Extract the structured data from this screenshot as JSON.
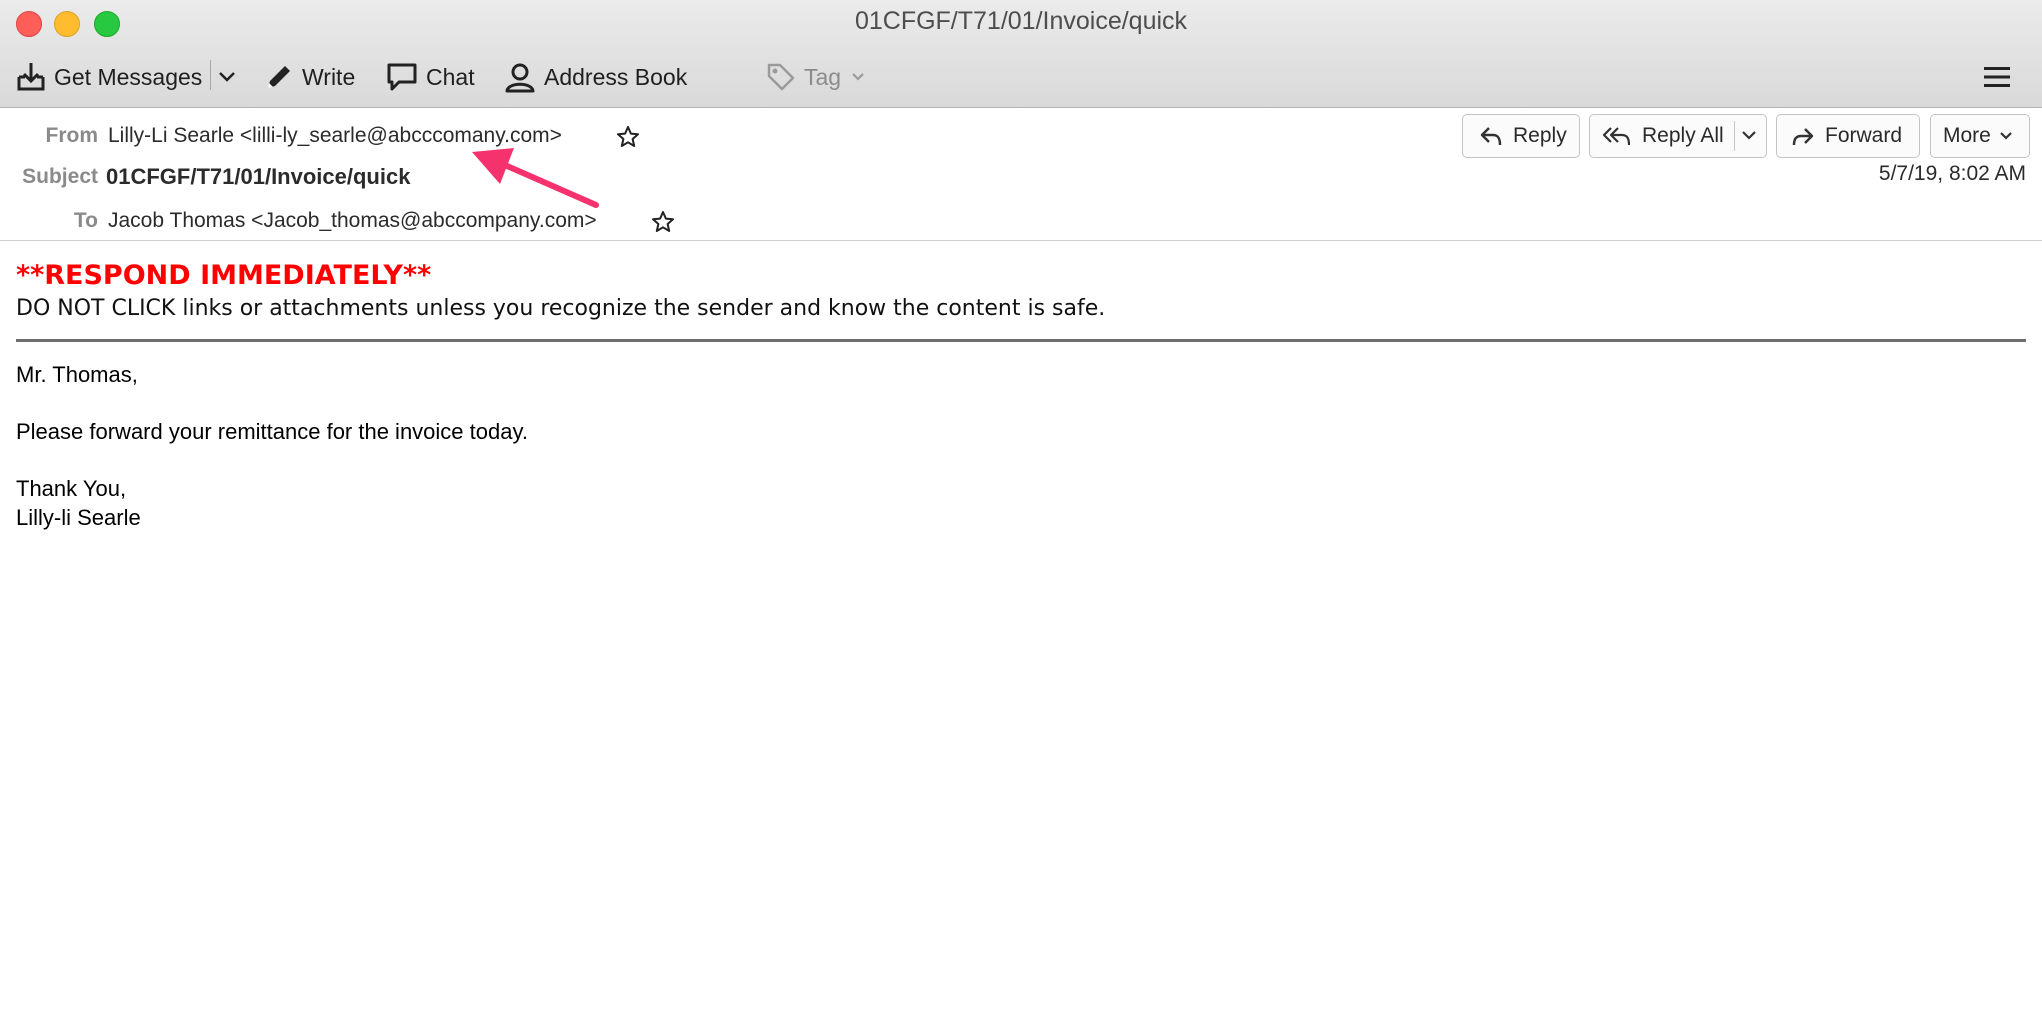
{
  "window": {
    "title": "01CFGF/T71/01/Invoice/quick"
  },
  "toolbar": {
    "get_messages": "Get Messages",
    "write": "Write",
    "chat": "Chat",
    "address_book": "Address Book",
    "tag": "Tag"
  },
  "header": {
    "from_label": "From",
    "from_value": "Lilly-Li Searle <lilli-ly_searle@abcccomany.com>",
    "subject_label": "Subject",
    "subject_value": "01CFGF/T71/01/Invoice/quick",
    "to_label": "To",
    "to_value": "Jacob Thomas <Jacob_thomas@abccompany.com>",
    "date": "5/7/19, 8:02 AM",
    "actions": {
      "reply": "Reply",
      "reply_all": "Reply All",
      "forward": "Forward",
      "more": "More"
    }
  },
  "banner": {
    "title": "**RESPOND IMMEDIATELY**",
    "text": "DO NOT CLICK links or attachments unless you recognize the sender and know the content is safe."
  },
  "message": {
    "greeting": "Mr. Thomas,",
    "body": "Please forward your remittance for the invoice today.",
    "closing": "Thank You,",
    "signature": "Lilly-li Searle"
  },
  "colors": {
    "banner_red": "#ff0000",
    "annotation_arrow": "#f5326e"
  }
}
